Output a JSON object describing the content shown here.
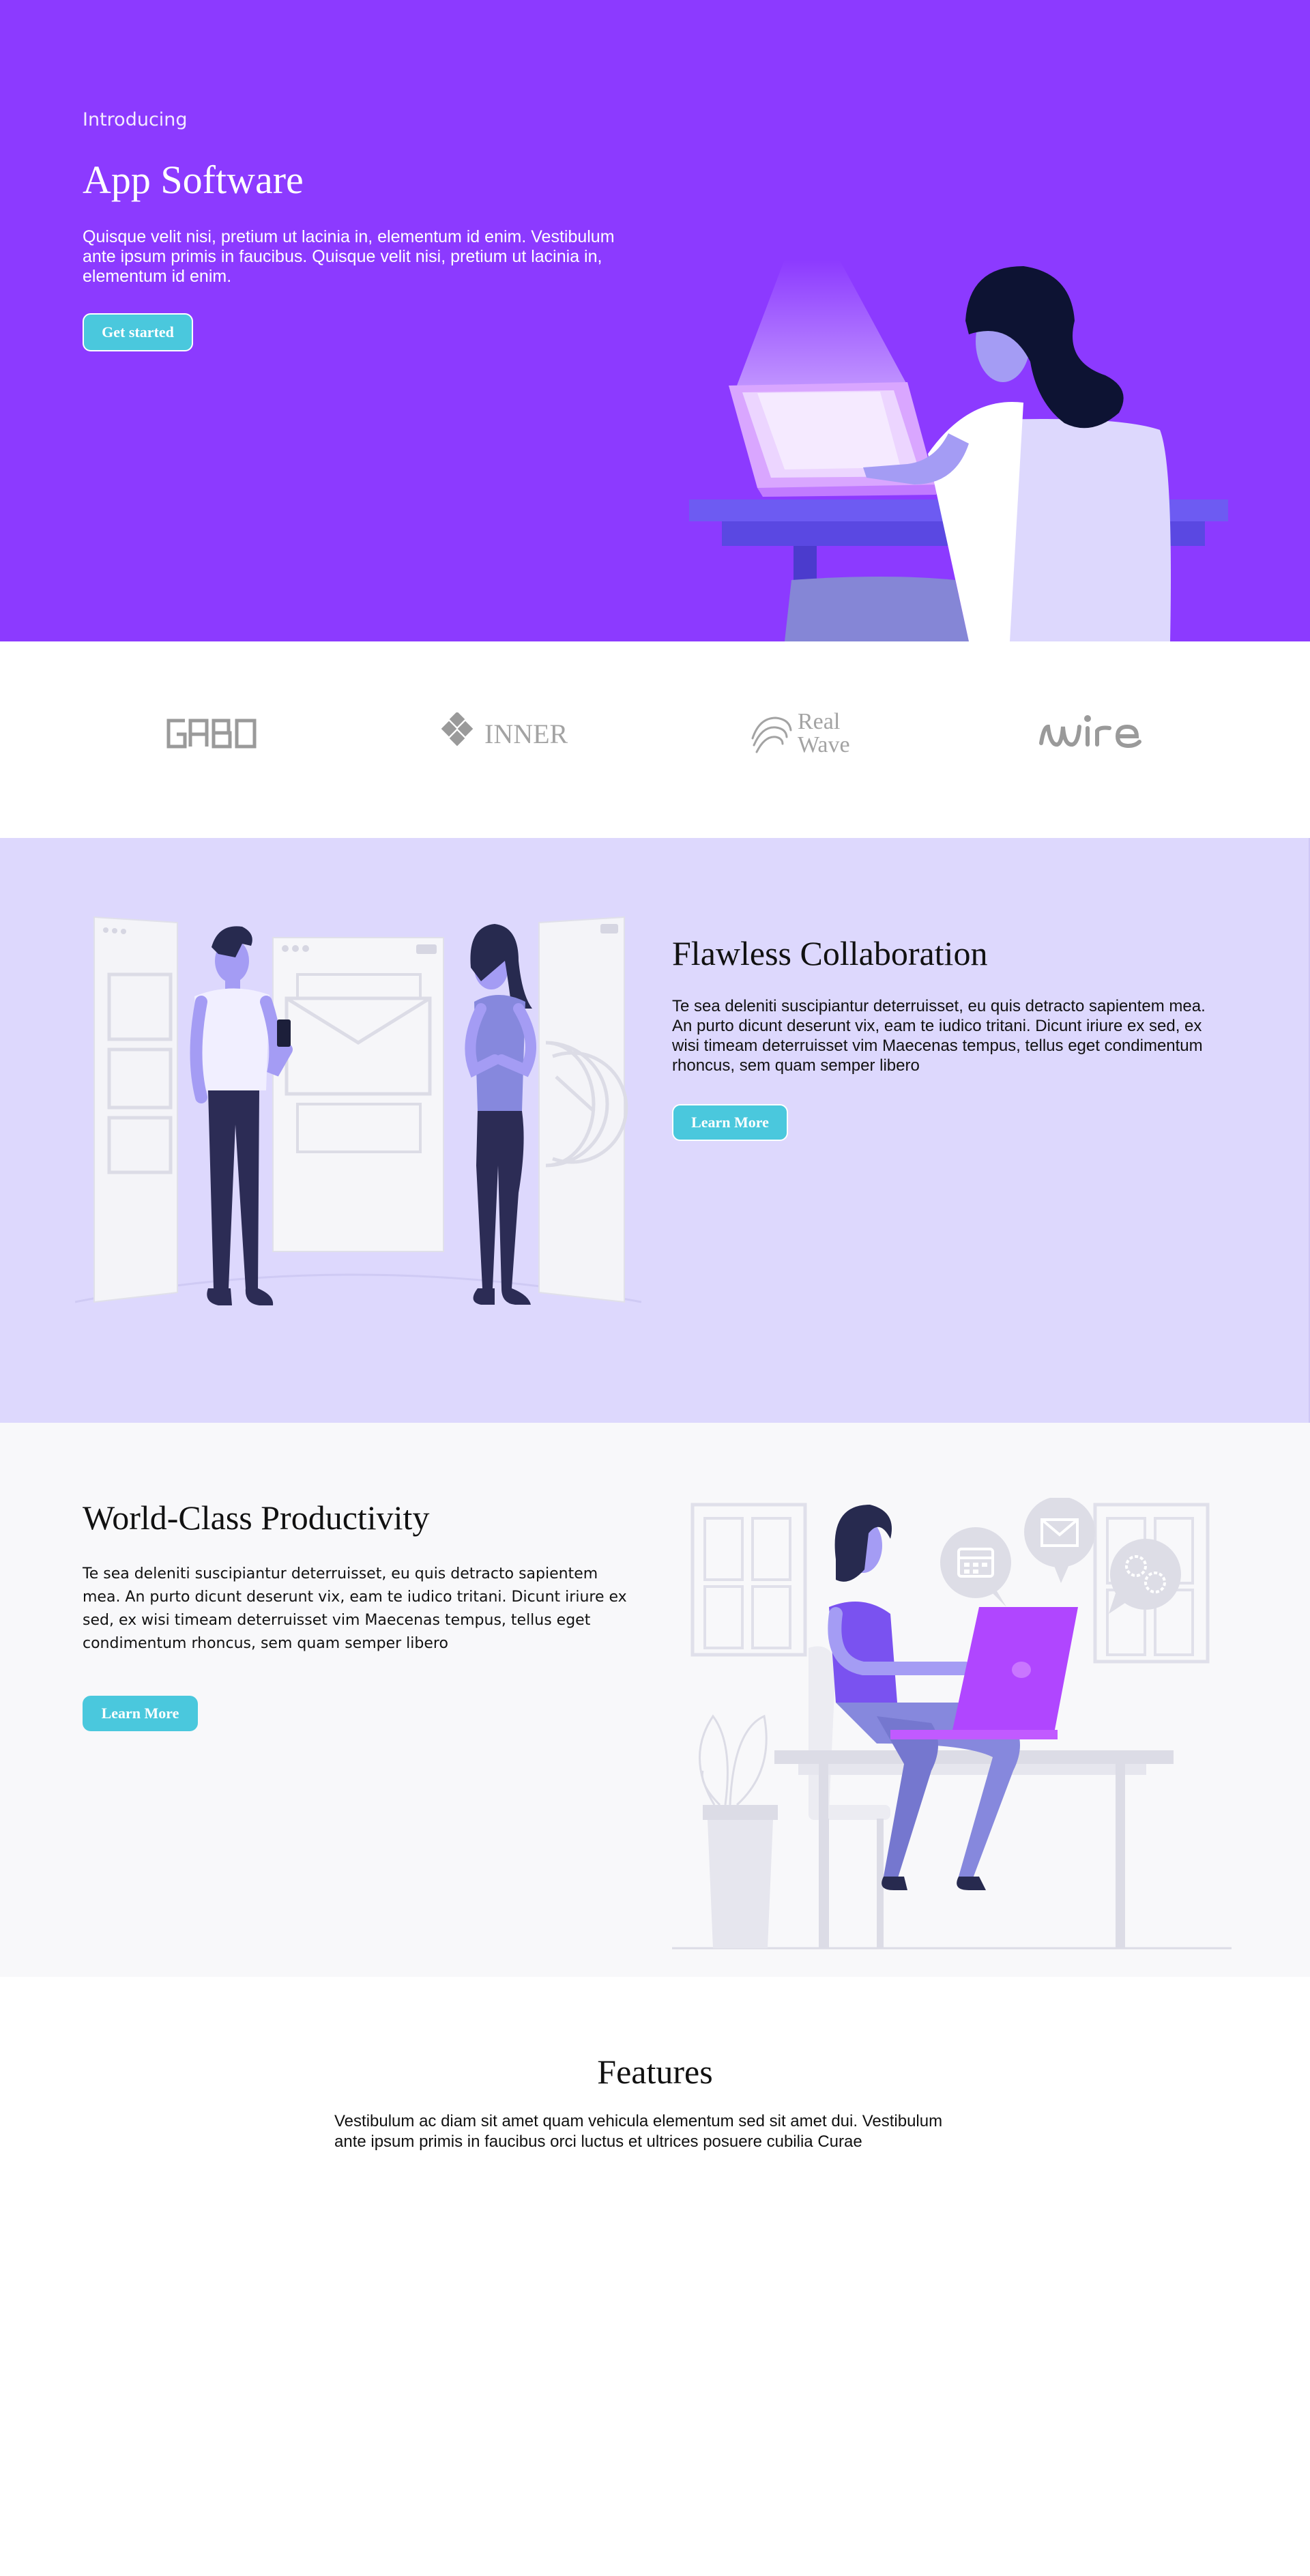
{
  "hero": {
    "eyebrow": "Introducing",
    "title": "App Software",
    "lead": "Quisque velit nisi, pretium ut lacinia in, elementum id enim. Vestibulum ante ipsum primis in faucibus. Quisque velit nisi, pretium ut lacinia in, elementum id enim.",
    "cta_label": "Get started",
    "background_color": "#8c3aff",
    "accent_color": "#4ac8dd"
  },
  "logos": {
    "items": [
      {
        "name": "GABO",
        "icon": "gabo-logo"
      },
      {
        "name": "INNER",
        "icon": "diamond-grid-icon"
      },
      {
        "name": "Real Wave",
        "line1": "Real",
        "line2": "Wave",
        "icon": "wave-icon"
      },
      {
        "name": "wire",
        "icon": "wire-logo"
      }
    ]
  },
  "collaboration": {
    "title": "Flawless Collaboration",
    "body": "Te sea deleniti suscipiantur deterruisset, eu quis detracto sapientem mea. An purto dicunt deserunt vix, eam te iudico tritani. Dicunt iriure ex sed, ex wisi timeam deterruisset vim Maecenas tempus, tellus eget condimentum rhoncus, sem quam semper libero",
    "cta_label": "Learn More",
    "background_color": "#ddd8fd"
  },
  "productivity": {
    "title": "World-Class Productivity",
    "body": "Te sea deleniti suscipiantur deterruisset, eu quis detracto sapientem mea. An purto dicunt deserunt vix, eam te iudico tritani. Dicunt iriure ex sed, ex wisi timeam deterruisset vim Maecenas tempus, tellus eget condimentum rhoncus, sem quam semper libero",
    "cta_label": "Learn More",
    "background_color": "#f8f8fa"
  },
  "features": {
    "title": "Features",
    "body": "Vestibulum ac diam sit amet quam vehicula elementum sed sit amet dui. Vestibulum ante ipsum primis in faucibus orci luctus et ultrices posuere cubilia Curae"
  }
}
